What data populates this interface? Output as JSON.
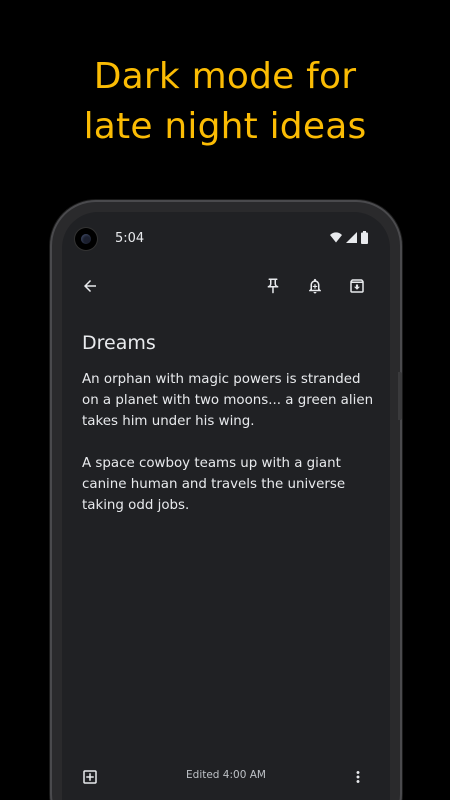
{
  "promo": {
    "headline_line1": "Dark mode for",
    "headline_line2": "late night ideas",
    "accent_color": "#fbbc04"
  },
  "status_bar": {
    "time": "5:04",
    "icons": [
      "wifi-icon",
      "signal-icon",
      "battery-icon"
    ]
  },
  "toolbar": {
    "back_icon": "arrow-back-icon",
    "actions": [
      "pin-icon",
      "reminder-add-icon",
      "archive-icon"
    ]
  },
  "note": {
    "title": "Dreams",
    "paragraph1": "An orphan with magic powers is stranded on a planet with two moons... a green alien takes him under his wing.",
    "paragraph2": "A space cowboy teams up with a giant canine human and travels the universe taking odd jobs."
  },
  "bottom_bar": {
    "add_icon": "add-box-icon",
    "edited_label": "Edited 4:00 AM",
    "more_icon": "more-vert-icon"
  },
  "theme": {
    "background": "#000000",
    "surface": "#202124",
    "text": "#e8eaed"
  }
}
